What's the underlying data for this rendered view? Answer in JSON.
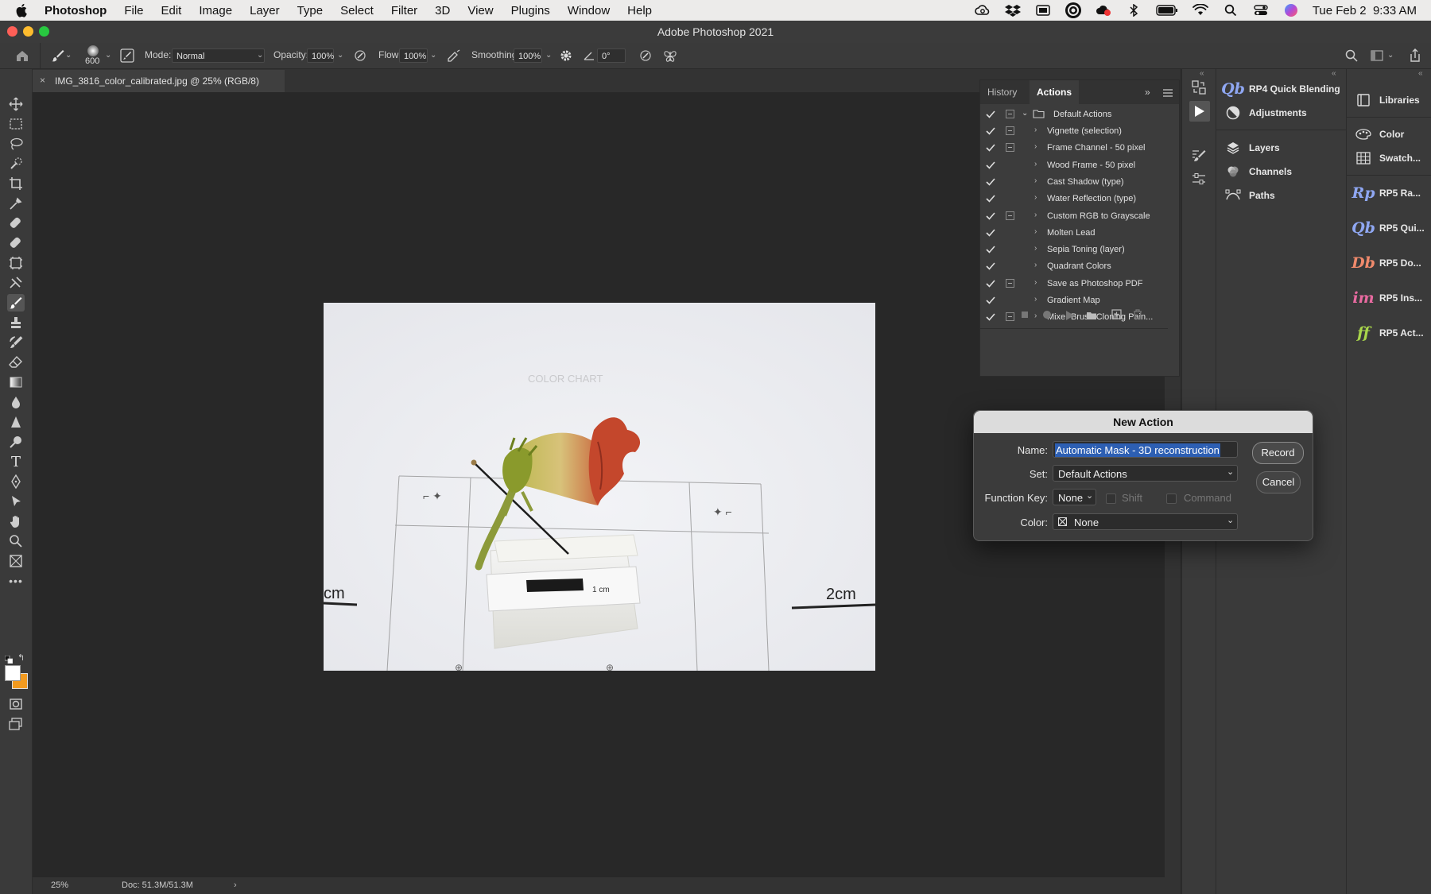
{
  "menubar": {
    "app_name": "Photoshop",
    "items": [
      "File",
      "Edit",
      "Image",
      "Layer",
      "Type",
      "Select",
      "Filter",
      "3D",
      "View",
      "Plugins",
      "Window",
      "Help"
    ],
    "status_icons": [
      "creative-cloud-icon",
      "dropbox-icon",
      "screen-mirroring-icon",
      "circle-logo-icon",
      "cloud-sync-icon",
      "bluetooth-icon",
      "battery-icon",
      "wifi-icon",
      "spotlight-search-icon",
      "control-center-icon",
      "siri-icon"
    ],
    "clock": "Tue Feb 2  9:33 AM"
  },
  "window": {
    "title": "Adobe Photoshop 2021"
  },
  "options": {
    "brush_size": "600",
    "mode_label": "Mode:",
    "mode_value": "Normal",
    "opacity_label": "Opacity:",
    "opacity_value": "100%",
    "flow_label": "Flow:",
    "flow_value": "100%",
    "smoothing_label": "Smoothing:",
    "smoothing_value": "100%",
    "angle_value": "0°"
  },
  "document": {
    "tab_title": "IMG_3816_color_calibrated.jpg @ 25% (RGB/8)",
    "zoom": "25%",
    "doc_info": "Doc: 51.3M/51.3M"
  },
  "photo": {
    "chart_text": "COLOR CHART",
    "label_1cm": "1 cm",
    "label_2cm_left": "cm",
    "label_2cm_right": "2cm"
  },
  "actions_panel": {
    "tabs": [
      "History",
      "Actions"
    ],
    "active_tab": "Actions",
    "set_name": "Default Actions",
    "items": [
      {
        "name": "Vignette (selection)",
        "dialog": true
      },
      {
        "name": "Frame Channel - 50 pixel",
        "dialog": true
      },
      {
        "name": "Wood Frame - 50 pixel",
        "dialog": false
      },
      {
        "name": "Cast Shadow (type)",
        "dialog": false
      },
      {
        "name": "Water Reflection (type)",
        "dialog": false
      },
      {
        "name": "Custom RGB to Grayscale",
        "dialog": true
      },
      {
        "name": "Molten Lead",
        "dialog": false
      },
      {
        "name": "Sepia Toning (layer)",
        "dialog": false
      },
      {
        "name": "Quadrant Colors",
        "dialog": false
      },
      {
        "name": "Save as Photoshop PDF",
        "dialog": true
      },
      {
        "name": "Gradient Map",
        "dialog": false
      },
      {
        "name": "Mixer Brush Cloning Pain...",
        "dialog": true
      }
    ]
  },
  "dock_middle": [
    {
      "icon": "Qb",
      "label": "RP4 Quick Blending",
      "color": "#8fa7f2"
    },
    {
      "icon": "adjustments-icon",
      "label": "Adjustments"
    },
    {
      "icon": "layers-icon",
      "label": "Layers"
    },
    {
      "icon": "channels-icon",
      "label": "Channels"
    },
    {
      "icon": "paths-icon",
      "label": "Paths"
    }
  ],
  "dock_right": [
    {
      "icon": "libraries-icon",
      "label": "Libraries"
    },
    {
      "icon": "color-icon",
      "label": "Color"
    },
    {
      "icon": "swatches-icon",
      "label": "Swatch..."
    },
    {
      "icon": "Rp",
      "label": "RP5 Ra...",
      "color": "#8fa7f2"
    },
    {
      "icon": "Qb",
      "label": "RP5 Qui...",
      "color": "#8fa7f2"
    },
    {
      "icon": "Db",
      "label": "RP5 Do...",
      "color": "#f08a6c"
    },
    {
      "icon": "im",
      "label": "RP5 Ins...",
      "color": "#e86aa0"
    },
    {
      "icon": "ff",
      "label": "RP5 Act...",
      "color": "#a9d64b"
    }
  ],
  "dialog": {
    "title": "New Action",
    "name_label": "Name:",
    "name_value": "Automatic Mask - 3D reconstruction",
    "set_label": "Set:",
    "set_value": "Default Actions",
    "function_key_label": "Function Key:",
    "function_key_value": "None",
    "shift_label": "Shift",
    "command_label": "Command",
    "color_label": "Color:",
    "color_value": "None",
    "record_button": "Record",
    "cancel_button": "Cancel",
    "selection_color": "#2d5fb3"
  }
}
